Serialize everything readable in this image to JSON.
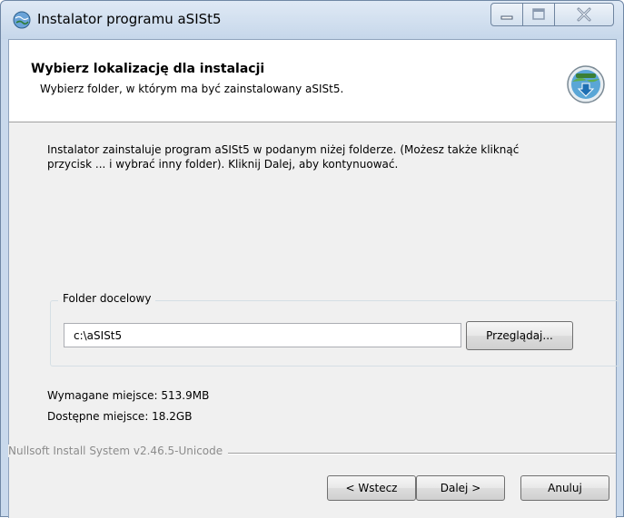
{
  "window": {
    "title": "Instalator programu aSISt5",
    "icon": "installer-globe-icon",
    "controls": [
      "minimize-icon",
      "maximize-icon",
      "close-icon"
    ]
  },
  "header": {
    "title": "Wybierz lokalizację dla instalacji",
    "subtitle": "Wybierz folder, w którym ma być zainstalowany aSISt5.",
    "icon": "installer-download-icon"
  },
  "body": {
    "intro_line1": "Instalator zainstaluje program aSISt5 w podanym niżej folderze. (Możesz także kliknąć",
    "intro_line2": "przycisk ... i wybrać inny folder). Kliknij Dalej, aby kontynuować."
  },
  "destination": {
    "group_label": "Folder docelowy",
    "path_value": "c:\\aSISt5",
    "browse_label": "Przeglądaj..."
  },
  "space": {
    "required": "Wymagane miejsce: 513.9MB",
    "available": "Dostępne miejsce: 18.2GB"
  },
  "branding": "Nullsoft Install System v2.46.5-Unicode",
  "buttons": {
    "back": "< Wstecz",
    "next": "Dalej >",
    "cancel": "Anuluj"
  }
}
